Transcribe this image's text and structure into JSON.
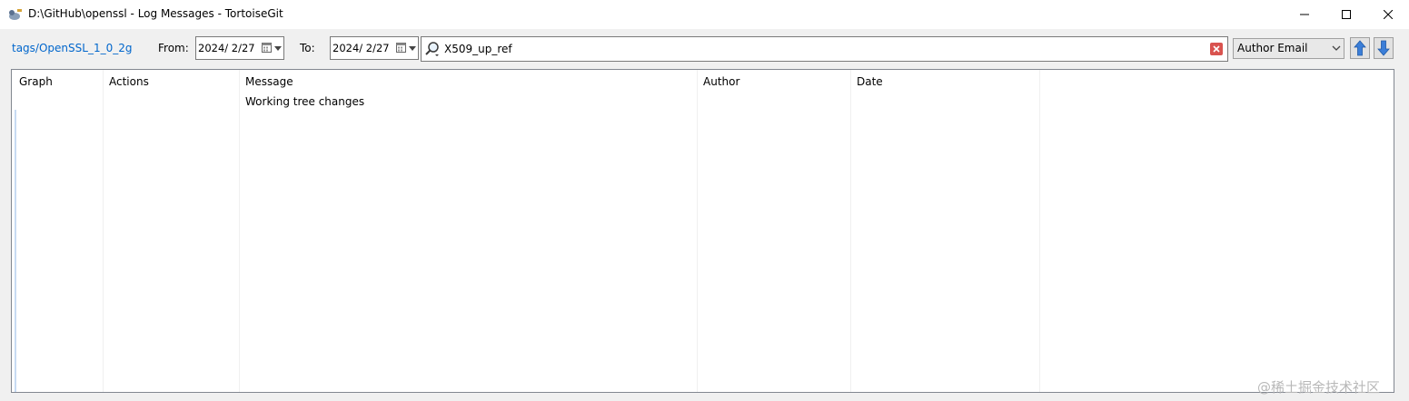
{
  "window": {
    "title": "D:\\GitHub\\openssl - Log Messages - TortoiseGit",
    "icons": [
      "app-icon",
      "minimize-icon",
      "maximize-icon",
      "close-icon"
    ]
  },
  "toolbar": {
    "branch_link": "tags/OpenSSL_1_0_2g",
    "from_label": "From:",
    "from_date": "2024/  2/27",
    "to_label": "To:",
    "to_date": "2024/  2/27",
    "search_value": "X509_up_ref",
    "filter_field": "Author Email",
    "icons": [
      "calendar-icon",
      "search-icon",
      "clear-icon",
      "arrow-up-icon",
      "arrow-down-icon"
    ]
  },
  "log_list": {
    "columns": [
      "Graph",
      "Actions",
      "Message",
      "Author",
      "Date"
    ],
    "rows": [
      {
        "graph": "",
        "actions": "",
        "message": "Working tree changes",
        "author": "",
        "date": ""
      }
    ]
  },
  "watermark": "@稀土掘金技术社区"
}
